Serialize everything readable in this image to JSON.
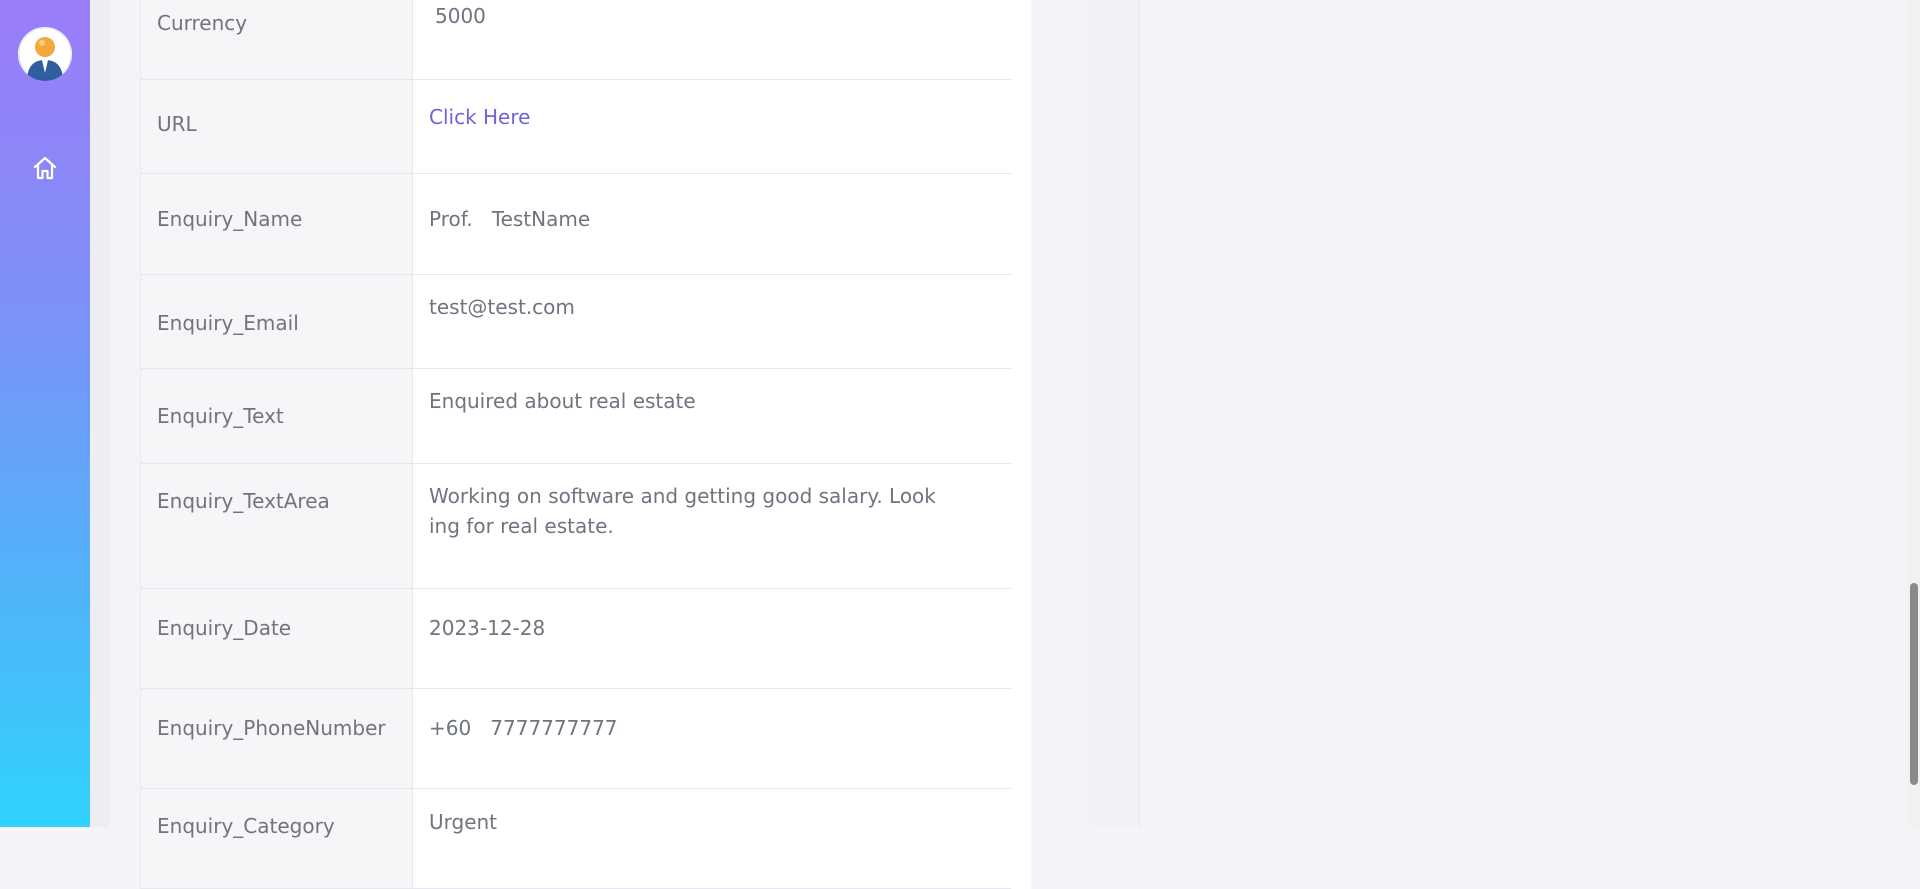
{
  "sidebar": {
    "avatar_icon": "user-avatar-icon",
    "home_icon": "home-icon"
  },
  "details": {
    "rows": [
      {
        "key": "currency",
        "label": "Currency",
        "value": "5000"
      },
      {
        "key": "url",
        "label": "URL",
        "value": "Click Here",
        "is_link": true
      },
      {
        "key": "enquiry_name",
        "label": "Enquiry_Name",
        "value": "Prof.   TestName"
      },
      {
        "key": "enquiry_email",
        "label": "Enquiry_Email",
        "value": "test@test.com"
      },
      {
        "key": "enquiry_text",
        "label": "Enquiry_Text",
        "value": "Enquired about real estate"
      },
      {
        "key": "enquiry_textarea",
        "label": "Enquiry_TextArea",
        "value": "Working on software and getting good salary. Looking for real estate."
      },
      {
        "key": "enquiry_date",
        "label": "Enquiry_Date",
        "value": "2023-12-28"
      },
      {
        "key": "enquiry_phone",
        "label": "Enquiry_PhoneNumber",
        "value": "+60   7777777777"
      },
      {
        "key": "enquiry_category",
        "label": "Enquiry_Category",
        "value": "Urgent"
      }
    ]
  },
  "colors": {
    "sidebar_top": "#9b7cf9",
    "sidebar_bottom": "#2fd3fb",
    "link": "#6e63d8",
    "text": "#707480"
  }
}
